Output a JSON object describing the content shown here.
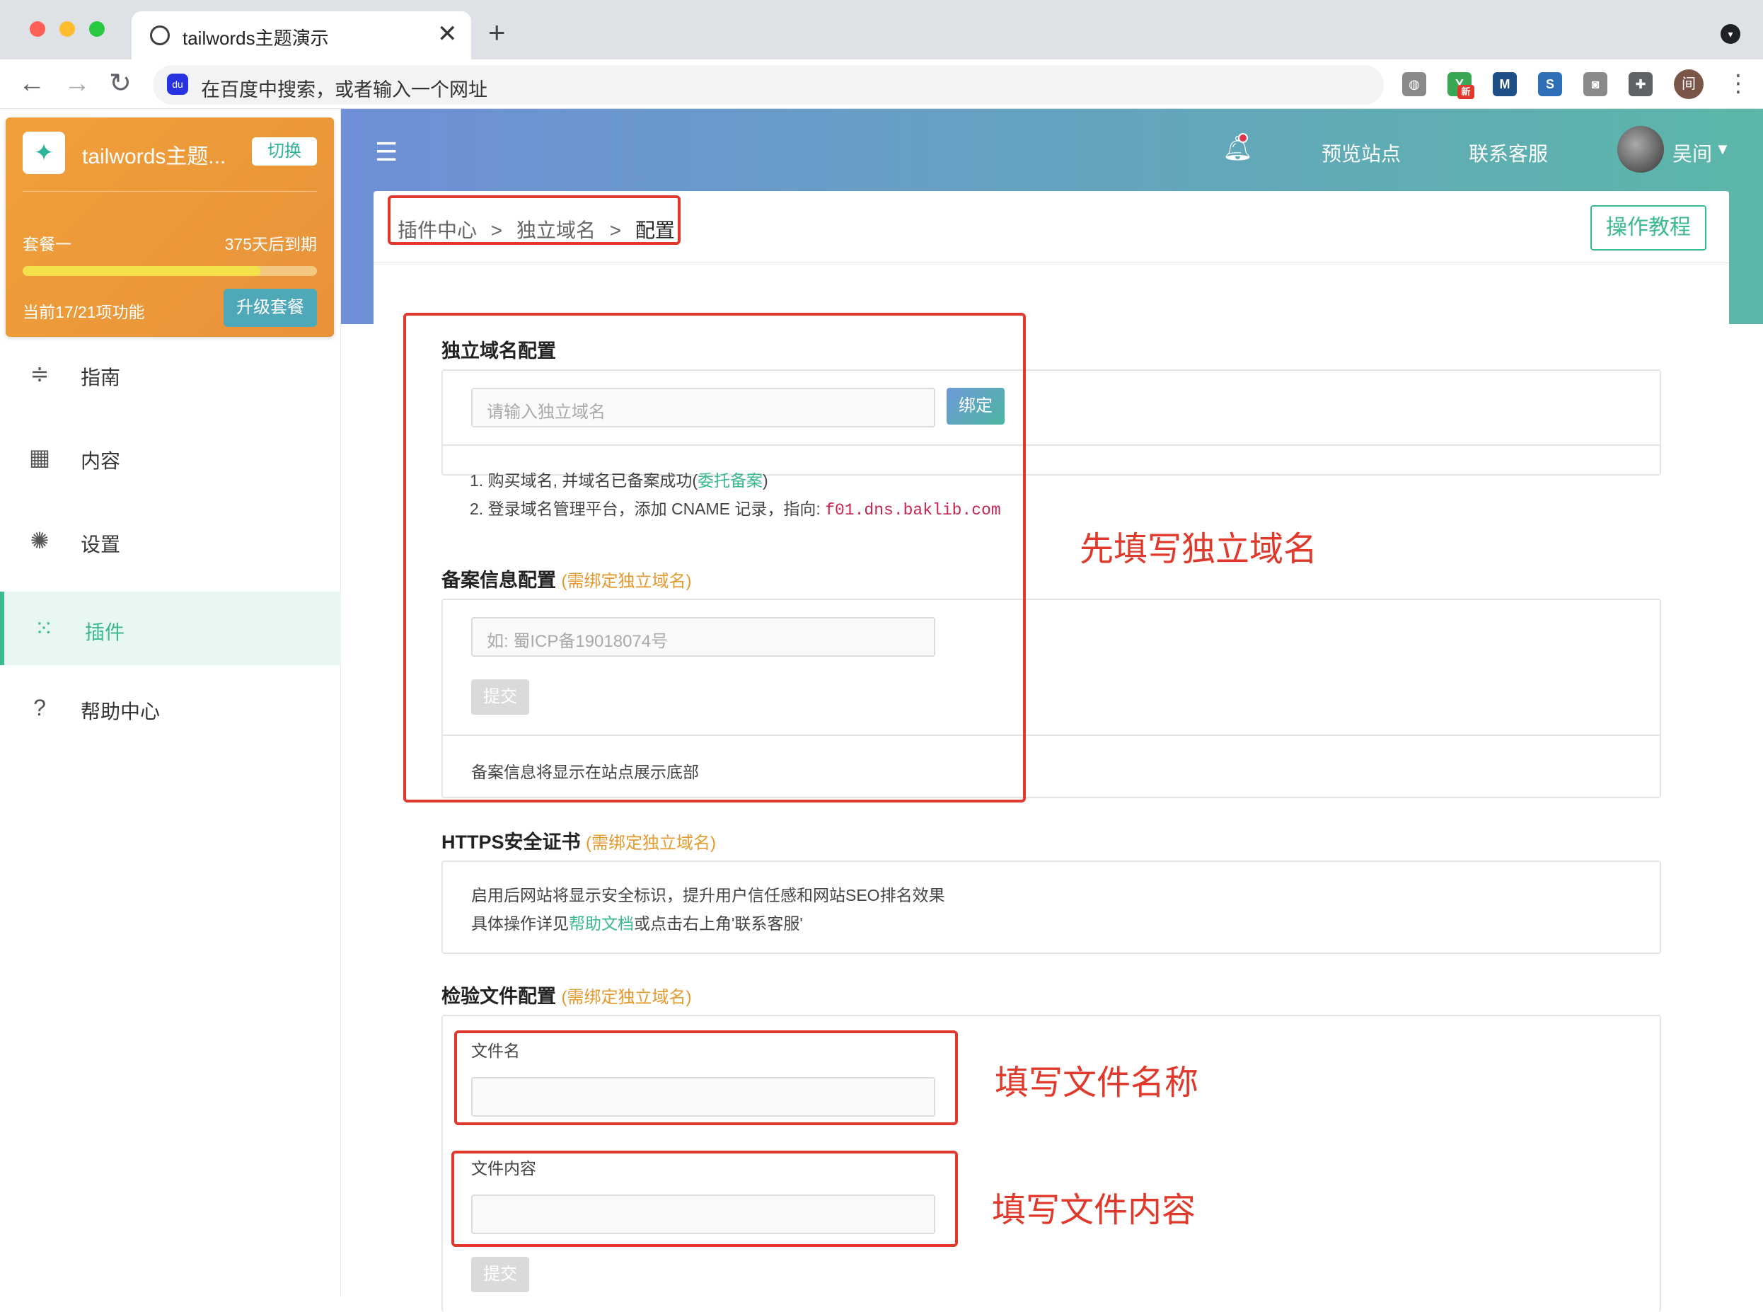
{
  "browser": {
    "tab_title": "tailwords主题演示",
    "tab_close": "✕",
    "new_tab": "+",
    "omnibox_placeholder": "在百度中搜索，或者输入一个网址",
    "baidu_badge": "du",
    "back_icon": "←",
    "forward_icon": "→",
    "reload_icon": "↻",
    "extensions": [
      {
        "name": "globe-extension-icon",
        "label": "◍",
        "color": "#8a8a8a"
      },
      {
        "name": "new-extension-icon",
        "label": "Y",
        "badge": "新",
        "color": "#3aa755"
      },
      {
        "name": "m-extension-icon",
        "label": "M",
        "color": "#1e4f86"
      },
      {
        "name": "s-extension-icon",
        "label": "S",
        "color": "#2f6fb8"
      },
      {
        "name": "camera-extension-icon",
        "label": "◙",
        "color": "#8a8a8a"
      },
      {
        "name": "puzzle-extension-icon",
        "label": "✚",
        "color": "#5f6368"
      }
    ],
    "profile_initial": "间",
    "menu_icon": "⋮"
  },
  "sidebar": {
    "site_name": "tailwords主题...",
    "switch_label": "切换",
    "plan_name": "套餐一",
    "plan_expire": "375天后到期",
    "plan_progress": 0.81,
    "plan_features": "当前17/21项功能",
    "upgrade_label": "升级套餐",
    "items": [
      {
        "label": "指南",
        "icon": "signpost-icon",
        "glyph": "≑"
      },
      {
        "label": "内容",
        "icon": "grid-icon",
        "glyph": "▦"
      },
      {
        "label": "设置",
        "icon": "gear-icon",
        "glyph": "✺"
      },
      {
        "label": "插件",
        "icon": "dots-grid-icon",
        "glyph": "⁙",
        "active": true
      },
      {
        "label": "帮助中心",
        "icon": "help-icon",
        "glyph": "?"
      }
    ]
  },
  "header": {
    "preview_site": "预览站点",
    "contact_support": "联系客服",
    "username": "吴间"
  },
  "breadcrumb": {
    "items": [
      "插件中心",
      "独立域名",
      "配置"
    ],
    "separator": ">",
    "tutorial_label": "操作教程"
  },
  "domain_config": {
    "title": "独立域名配置",
    "input_placeholder": "请输入独立域名",
    "bind_label": "绑定",
    "step1_prefix": "1. 购买域名, 并域名已备案成功(",
    "step1_link": "委托备案",
    "step1_suffix": ")",
    "step2_prefix": "2. 登录域名管理平台，添加 CNAME 记录，指向: ",
    "step2_code": "f01.dns.baklib.com"
  },
  "icp_config": {
    "title": "备案信息配置",
    "note": "(需绑定独立域名)",
    "input_placeholder": "如: 蜀ICP备19018074号",
    "submit_label": "提交",
    "footer_text": "备案信息将显示在站点展示底部"
  },
  "https_config": {
    "title": "HTTPS安全证书",
    "note": "(需绑定独立域名)",
    "line1": "启用后网站将显示安全标识，提升用户信任感和网站SEO排名效果",
    "line2_prefix": "具体操作详见",
    "line2_link": "帮助文档",
    "line2_suffix": "或点击右上角'联系客服'"
  },
  "verify_config": {
    "title": "检验文件配置",
    "note": "(需绑定独立域名)",
    "filename_label": "文件名",
    "content_label": "文件内容",
    "submit_label": "提交"
  },
  "annotations": {
    "domain_note": "先填写独立域名",
    "filename_note": "填写文件名称",
    "content_note": "填写文件内容"
  }
}
